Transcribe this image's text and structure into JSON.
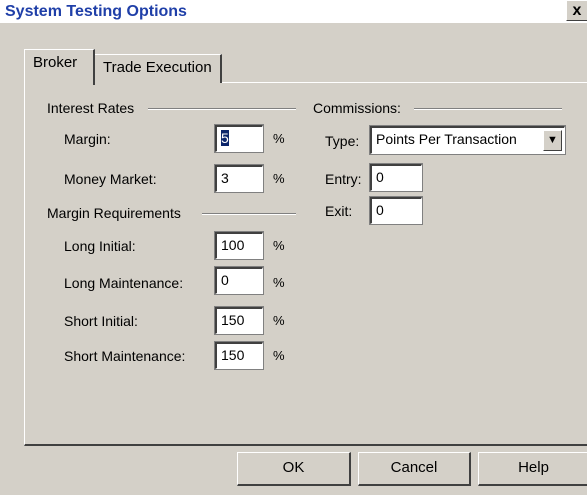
{
  "window": {
    "title": "System Testing Options",
    "close_glyph": "x"
  },
  "tabs": [
    {
      "label": "Broker",
      "active": true
    },
    {
      "label": "Trade Execution",
      "active": false
    }
  ],
  "interest_rates": {
    "heading": "Interest Rates",
    "margin_label": "Margin:",
    "margin_value": "5",
    "money_market_label": "Money Market:",
    "money_market_value": "3"
  },
  "margin_requirements": {
    "heading": "Margin Requirements",
    "long_initial_label": "Long Initial:",
    "long_initial_value": "100",
    "long_maintenance_label": "Long Maintenance:",
    "long_maintenance_value": "0",
    "short_initial_label": "Short Initial:",
    "short_initial_value": "150",
    "short_maintenance_label": "Short Maintenance:",
    "short_maintenance_value": "150"
  },
  "percent_sign": "%",
  "commissions": {
    "heading": "Commissions:",
    "type_label": "Type:",
    "type_value": "Points Per Transaction",
    "entry_label": "Entry:",
    "entry_value": "0",
    "exit_label": "Exit:",
    "exit_value": "0"
  },
  "buttons": {
    "ok": "OK",
    "cancel": "Cancel",
    "help": "Help"
  },
  "colors": {
    "title_text": "#1f3fa8",
    "dialog_face": "#d4d0c8",
    "selection": "#0a246a"
  },
  "icons": {
    "close": "close-icon",
    "dropdown": "chevron-down-icon"
  }
}
